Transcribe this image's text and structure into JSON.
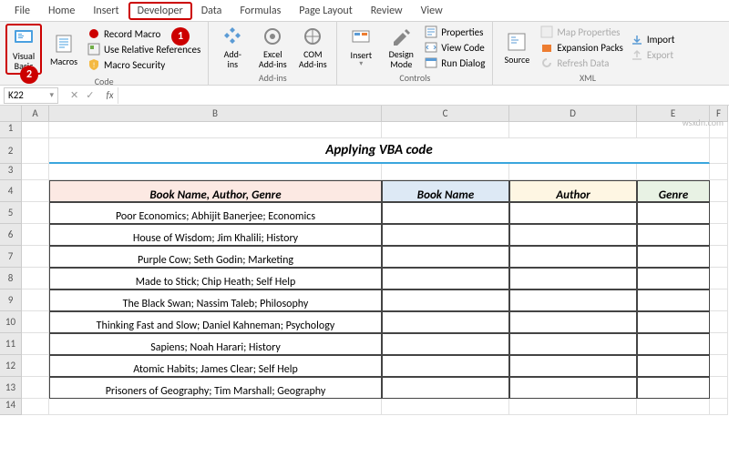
{
  "menu": {
    "tabs": [
      "File",
      "Home",
      "Insert",
      "Developer",
      "Data",
      "Formulas",
      "Page Layout",
      "Review",
      "View"
    ],
    "active": "Developer"
  },
  "ribbon": {
    "code": {
      "label": "Code",
      "visual_basic": "Visual\nBasic",
      "macros": "Macros",
      "record": "Record Macro",
      "relative": "Use Relative References",
      "security": "Macro Security"
    },
    "addins": {
      "label": "Add-ins",
      "addins": "Add-\nins",
      "excel": "Excel\nAdd-ins",
      "com": "COM\nAdd-ins"
    },
    "controls": {
      "label": "Controls",
      "insert": "Insert",
      "design": "Design\nMode",
      "properties": "Properties",
      "viewcode": "View Code",
      "rundialog": "Run Dialog"
    },
    "xml": {
      "label": "XML",
      "source": "Source",
      "mapprops": "Map Properties",
      "expansion": "Expansion Packs",
      "refresh": "Refresh Data",
      "import": "Import",
      "export": "Export"
    }
  },
  "callouts": {
    "c1": "1",
    "c2": "2"
  },
  "namebox": "K22",
  "fx": "fx",
  "columns": [
    "A",
    "B",
    "C",
    "D",
    "E",
    "F"
  ],
  "rows": [
    "1",
    "2",
    "3",
    "4",
    "5",
    "6",
    "7",
    "8",
    "9",
    "10",
    "11",
    "12",
    "13",
    "14"
  ],
  "title": "Applying VBA code",
  "headers": {
    "b": "Book Name, Author, Genre",
    "c": "Book Name",
    "d": "Author",
    "e": "Genre"
  },
  "data": [
    "Poor Economics; Abhijit Banerjee; Economics",
    "House of Wisdom; Jim Khalili; History",
    "Purple Cow; Seth Godin; Marketing",
    "Made to Stick; Chip Heath; Self Help",
    "The Black Swan; Nassim Taleb; Philosophy",
    "Thinking Fast and Slow; Daniel Kahneman; Psychology",
    "Sapiens; Noah Harari; History",
    "Atomic Habits; James Clear; Self Help",
    "Prisoners of Geography; Tim Marshall; Geography"
  ],
  "watermark": "wsxdn.com"
}
